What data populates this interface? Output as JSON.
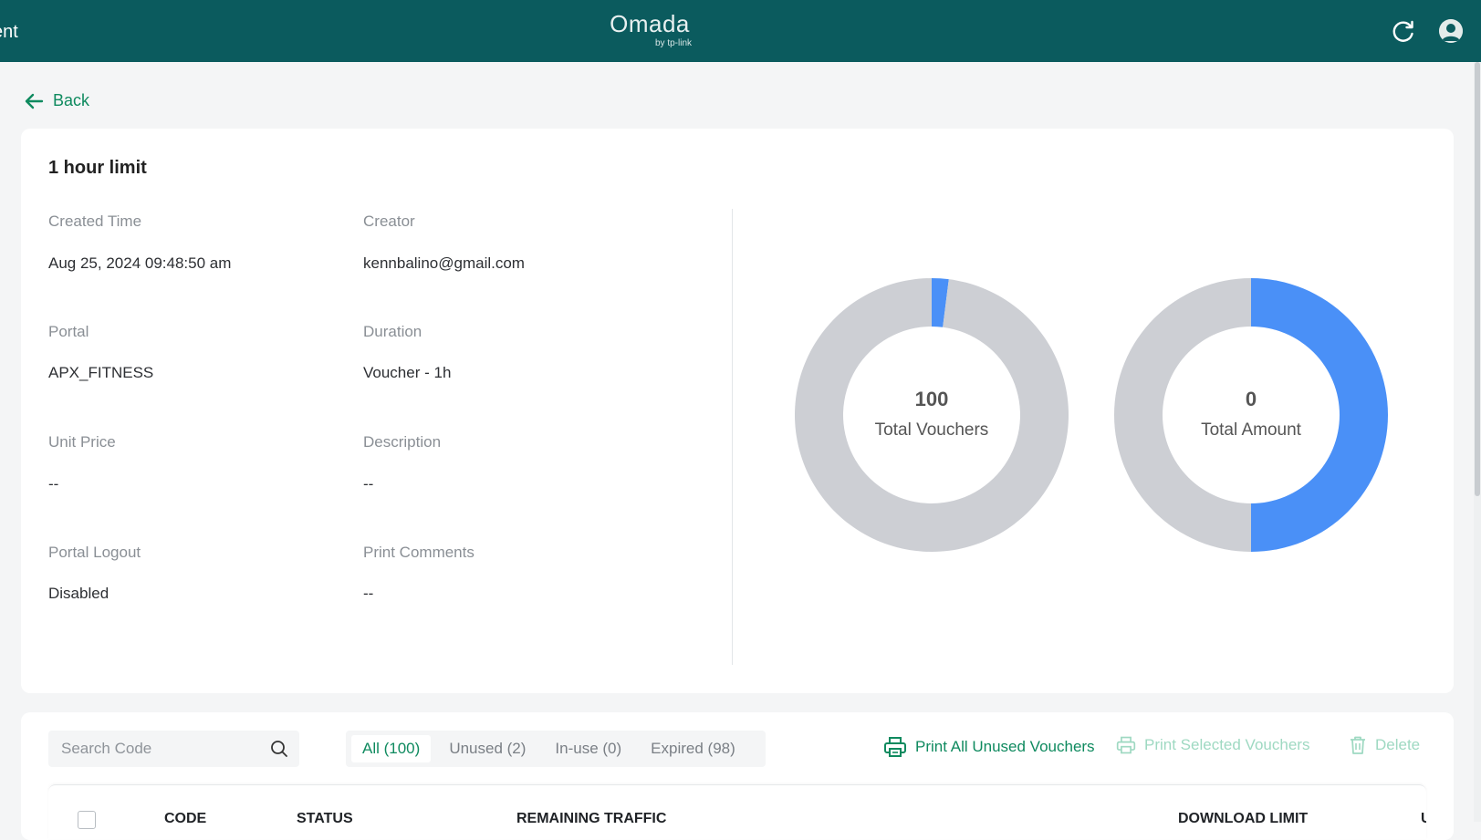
{
  "header": {
    "app_title_fragment": "ent",
    "logo_text": "Omada",
    "logo_sub": "by tp-link"
  },
  "back_label": "Back",
  "voucher_group": {
    "title": "1 hour limit",
    "fields": {
      "created_time": {
        "label": "Created Time",
        "value": "Aug 25, 2024 09:48:50 am"
      },
      "creator": {
        "label": "Creator",
        "value": "kennbalino@gmail.com"
      },
      "portal": {
        "label": "Portal",
        "value": "APX_FITNESS"
      },
      "duration": {
        "label": "Duration",
        "value": "Voucher - 1h"
      },
      "unit_price": {
        "label": "Unit Price",
        "value": "--"
      },
      "description": {
        "label": "Description",
        "value": "--"
      },
      "portal_logout": {
        "label": "Portal Logout",
        "value": "Disabled"
      },
      "print_comments": {
        "label": "Print Comments",
        "value": "--"
      }
    }
  },
  "chart_data": [
    {
      "type": "pie",
      "title": "",
      "center_value": "100",
      "center_label": "Total Vouchers",
      "categories": [
        "Unused",
        "In-use",
        "Expired"
      ],
      "values": [
        2,
        0,
        98
      ],
      "colors": [
        "#4a90f7",
        "#3dbb72",
        "#cdcfd4"
      ]
    },
    {
      "type": "pie",
      "title": "",
      "center_value": "0",
      "center_label": "Total Amount",
      "values": [
        0.5,
        0.5
      ],
      "colors": [
        "#4a90f7",
        "#cdcfd4"
      ]
    }
  ],
  "colors": {
    "header_bg": "#0b5b5e",
    "accent": "#0f8a5f",
    "blue": "#4a90f7",
    "green": "#3dbb72",
    "gray": "#cdcfd4"
  },
  "table_toolbar": {
    "search_placeholder": "Search Code",
    "tabs": [
      {
        "label": "All (100)",
        "active": true
      },
      {
        "label": "Unused (2)",
        "active": false
      },
      {
        "label": "In-use (0)",
        "active": false
      },
      {
        "label": "Expired (98)",
        "active": false
      }
    ],
    "actions": {
      "print_all": "Print All Unused Vouchers",
      "print_selected": "Print Selected Vouchers",
      "delete": "Delete"
    }
  },
  "table": {
    "columns": [
      "CODE",
      "STATUS",
      "REMAINING TRAFFIC",
      "DOWNLOAD LIMIT",
      "U"
    ]
  }
}
